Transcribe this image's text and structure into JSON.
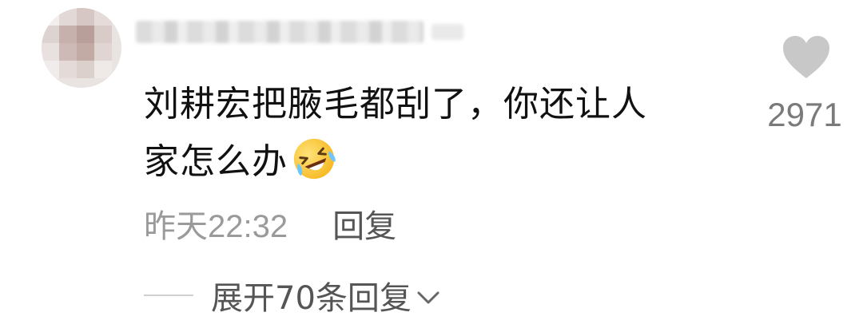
{
  "comment": {
    "text_line1": "刘耕宏把腋毛都刮了，你还让人",
    "text_line2": "家怎么办",
    "emoji": "laughing-crying-emoji",
    "like": {
      "icon": "heart-icon",
      "count": "2971",
      "color": "#c8c8c8"
    },
    "timestamp": "昨天22:32",
    "reply_label": "回复",
    "expand_label": "展开70条回复",
    "expand_icon": "chevron-down-icon"
  },
  "colors": {
    "text_primary": "#111111",
    "text_meta": "#9a9a9a",
    "text_action": "#555555",
    "icon_gray": "#c8c8c8"
  }
}
